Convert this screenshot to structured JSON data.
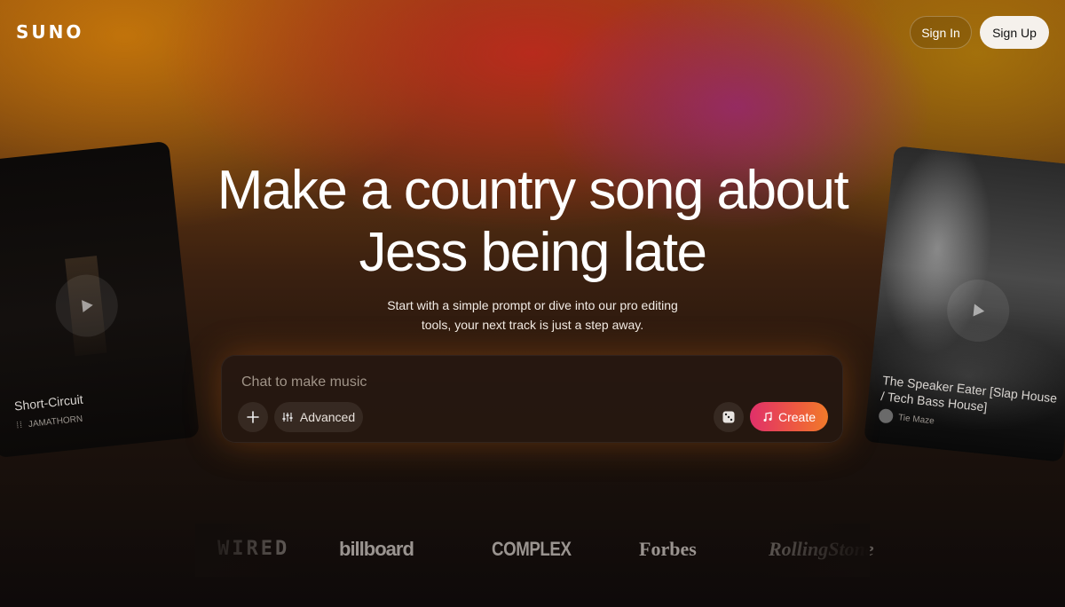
{
  "header": {
    "logo_text": "SUNO",
    "signin_label": "Sign In",
    "signup_label": "Sign Up"
  },
  "hero": {
    "title_line1": "Make a country song about",
    "title_line2": "Jess being late",
    "subtitle_line1": "Start with a simple prompt or dive into our pro editing",
    "subtitle_line2": "tools, your next track is just a step away."
  },
  "prompt": {
    "placeholder": "Chat to make music",
    "add_icon": "plus-icon",
    "advanced_label": "Advanced",
    "advanced_icon": "sliders-icon",
    "random_icon": "dice-icon",
    "create_label": "Create",
    "create_icon": "music-note-icon"
  },
  "cards": {
    "left": {
      "title": "Short-Circuit",
      "artist": "JAMATHORN",
      "play_icon": "play-icon"
    },
    "right": {
      "title": "The Speaker Eater [Slap House / Tech Bass House]",
      "artist": "Tie Maze",
      "play_icon": "play-icon"
    }
  },
  "press": {
    "logos": [
      "WIRED",
      "billboard",
      "COMPLEX",
      "Forbes",
      "RollingStone"
    ]
  },
  "colors": {
    "create_gradient_start": "#e0306a",
    "create_gradient_end": "#f07a2a",
    "signup_bg": "#f5f1ec"
  }
}
